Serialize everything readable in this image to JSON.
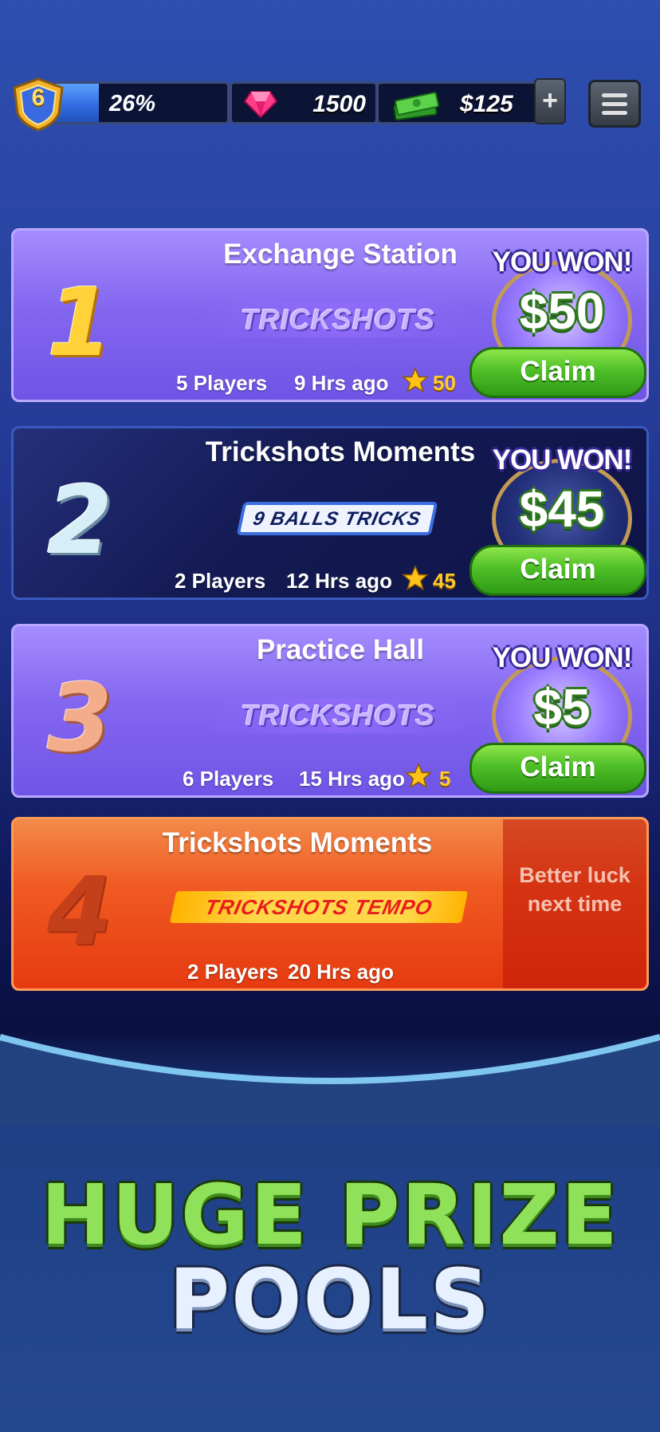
{
  "hud": {
    "level": "6",
    "level_progress_label": "26%",
    "level_progress": 0.26,
    "gems": "1500",
    "cash": "$125",
    "plus_label": "+"
  },
  "matches": [
    {
      "rank": "1",
      "title": "Exchange Station",
      "mode": "TRICKSHOTS",
      "players": "5 Players",
      "time": "9 Hrs ago",
      "stars": "50",
      "result": "YOU WON!",
      "prize": "$50",
      "claim_label": "Claim"
    },
    {
      "rank": "2",
      "title": "Trickshots Moments",
      "mode": "9 BALLS TRICKS",
      "players": "2 Players",
      "time": "12 Hrs ago",
      "stars": "45",
      "result": "YOU WON!",
      "prize": "$45",
      "claim_label": "Claim"
    },
    {
      "rank": "3",
      "title": "Practice Hall",
      "mode": "TRICKSHOTS",
      "players": "6 Players",
      "time": "15 Hrs ago",
      "stars": "5",
      "result": "YOU WON!",
      "prize": "$5",
      "claim_label": "Claim"
    },
    {
      "rank": "4",
      "title": "Trickshots Moments",
      "mode": "TRICKSHOTS TEMPO",
      "players": "2 Players",
      "time": "20 Hrs ago",
      "result_line1": "Better luck",
      "result_line2": "next time"
    }
  ],
  "slogan": {
    "line1": "HUGE PRIZE",
    "line2": "POOLS"
  },
  "colors": {
    "claim_green": "#4fbf28",
    "card_purple": "#8467f0",
    "card_navy": "#141b55",
    "card_orange": "#f05a22",
    "slogan_green": "#8fe15a"
  }
}
